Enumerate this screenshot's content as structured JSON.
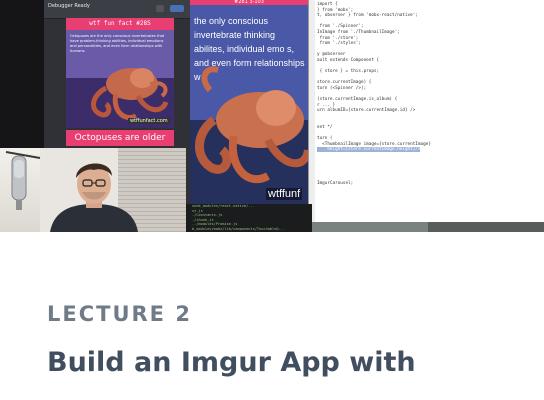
{
  "course_card": {
    "lecture_label": "LECTURE 2",
    "title": "Build an Imgur App with"
  },
  "thumbnail": {
    "debugger_window": {
      "title": "Debugger Ready",
      "banner_top": "wtf fun fact #285",
      "body_text": "Octopuses are the only conscious invertebrates that have problem-thinking abilities, individual emotions and personalities, and even form relationships with humans.",
      "watermark": "wtffunfact.com",
      "banner_bottom": "Octopuses are older"
    },
    "main_screen": {
      "header": "#281   3-103",
      "body_text": "the only conscious invertebrate thinking abilites, individual emo s, and even form relationships w",
      "watermark": "wtffunf"
    },
    "code_editor": {
      "lines": [
        "import {",
        "} from 'mobx';",
        "t, observer } from 'mobx-react/native';",
        "",
        " from './Spinner';",
        "InImage from './ThumbnailImage';",
        " from './store';",
        " from './styles';",
        "",
        "y @observer",
        "ault extends Component {",
        "",
        " { store } = this.props;",
        "",
        "store.currentImage) {",
        "turn (<Spinner />);",
        "",
        "(store.currentImage.is_album) {",
        "r ... }",
        "urn albumID={store.currentImage.id} />",
        "",
        "",
        "ent */",
        "",
        "turn (",
        "  <ThumbnailImage image={store.currentImage}",
        "    height={store.currentImage.height}/>",
        "",
        "",
        "",
        "",
        "",
        "ImgurCarousel;"
      ],
      "highlight_text": "height={store.currentImage.height}/>"
    },
    "terminal": {
      "lines": [
        "node_modules/react-native/...",
        "xt.js",
        "./Constants.js",
        "./chunk.js",
        "../modules/Promise.js",
        "b_modules/mobx/lib/components/TouchableO..."
      ]
    }
  },
  "colors": {
    "lecture_label": "#6f7b87",
    "title": "#414e60",
    "banner": "#e93e72"
  }
}
